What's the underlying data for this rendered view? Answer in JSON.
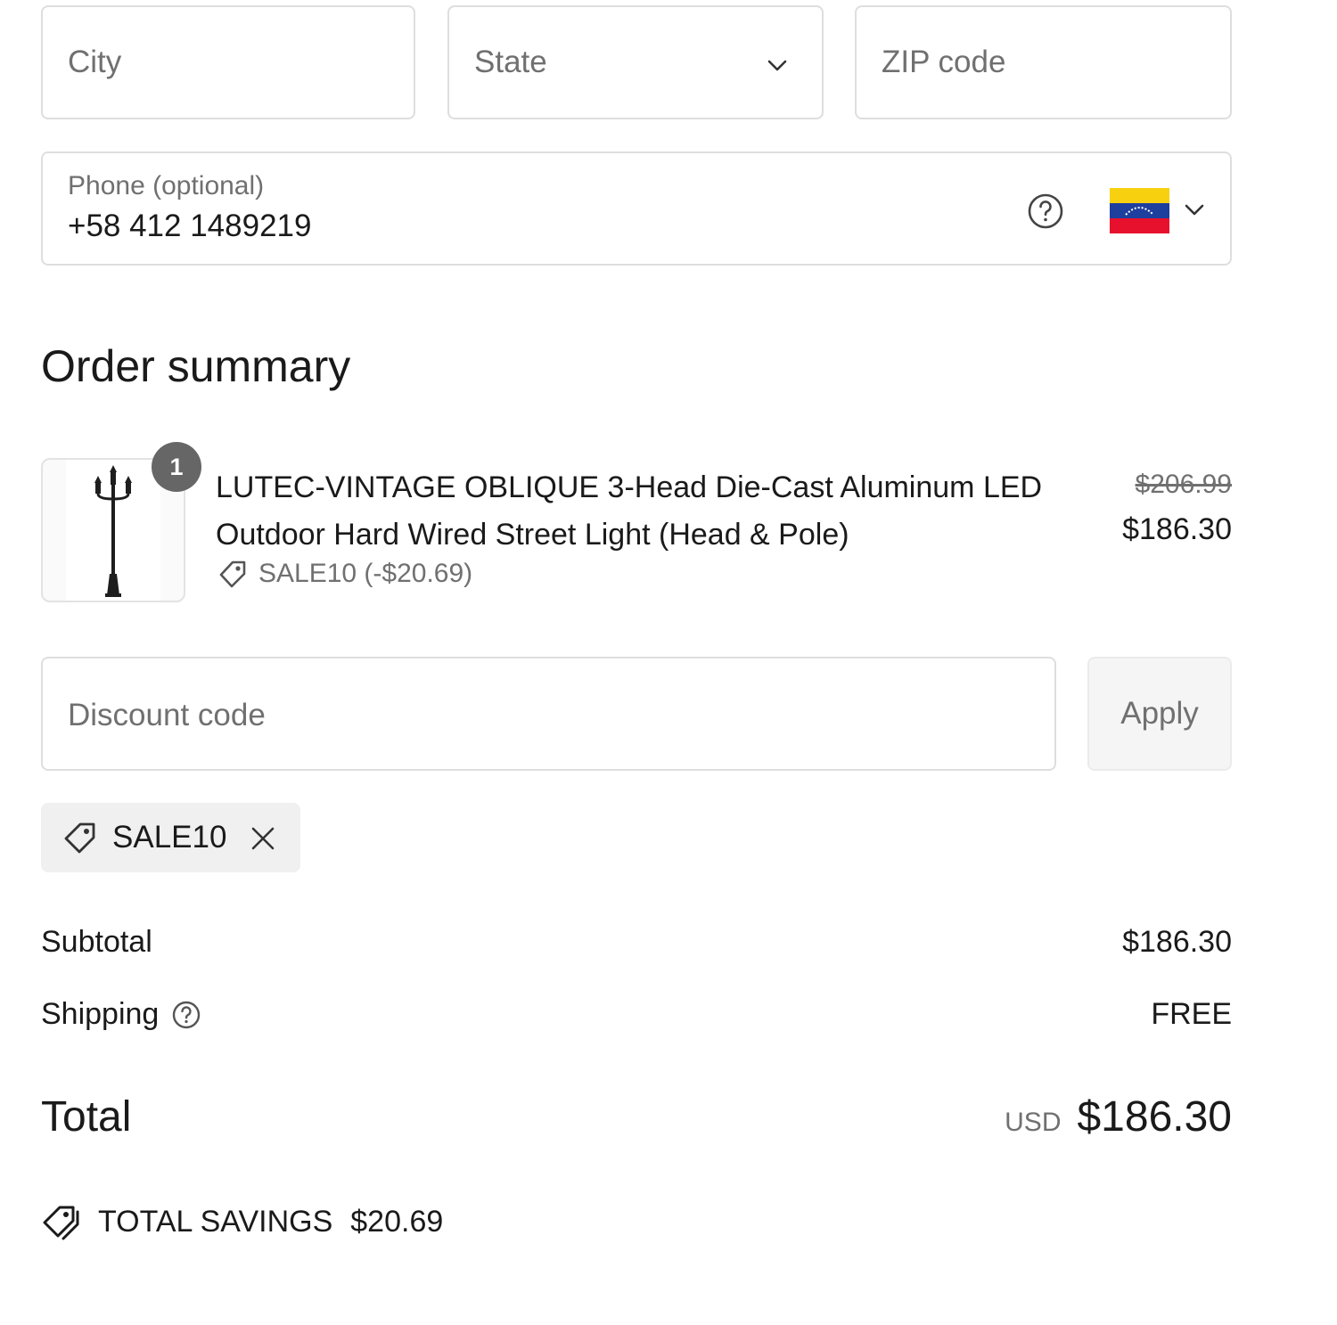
{
  "address": {
    "city_placeholder": "City",
    "state_placeholder": "State",
    "zip_placeholder": "ZIP code"
  },
  "phone": {
    "label": "Phone (optional)",
    "value": "+58 412 1489219",
    "country_flag": "venezuela-flag-icon"
  },
  "order_summary": {
    "heading": "Order summary",
    "item": {
      "quantity": "1",
      "title": "LUTEC-VINTAGE OBLIQUE 3-Head Die-Cast Aluminum LED Outdoor Hard Wired Street Light (Head & Pole)",
      "discount_text": "SALE10 (-$20.69)",
      "original_price": "$206.99",
      "price": "$186.30"
    },
    "discount": {
      "placeholder": "Discount code",
      "apply_label": "Apply",
      "applied_code": "SALE10"
    },
    "subtotal_label": "Subtotal",
    "subtotal_value": "$186.30",
    "shipping_label": "Shipping",
    "shipping_value": "FREE",
    "total_label": "Total",
    "total_currency": "USD",
    "total_value": "$186.30",
    "savings_label": "TOTAL SAVINGS",
    "savings_value": "$20.69"
  },
  "colors": {
    "border": "#dedede",
    "muted_text": "#707070",
    "badge": "#666666",
    "chip_bg": "#f0f0f0",
    "flag_yellow": "#f7d10f",
    "flag_blue": "#1d3f9e",
    "flag_red": "#e8112d"
  }
}
